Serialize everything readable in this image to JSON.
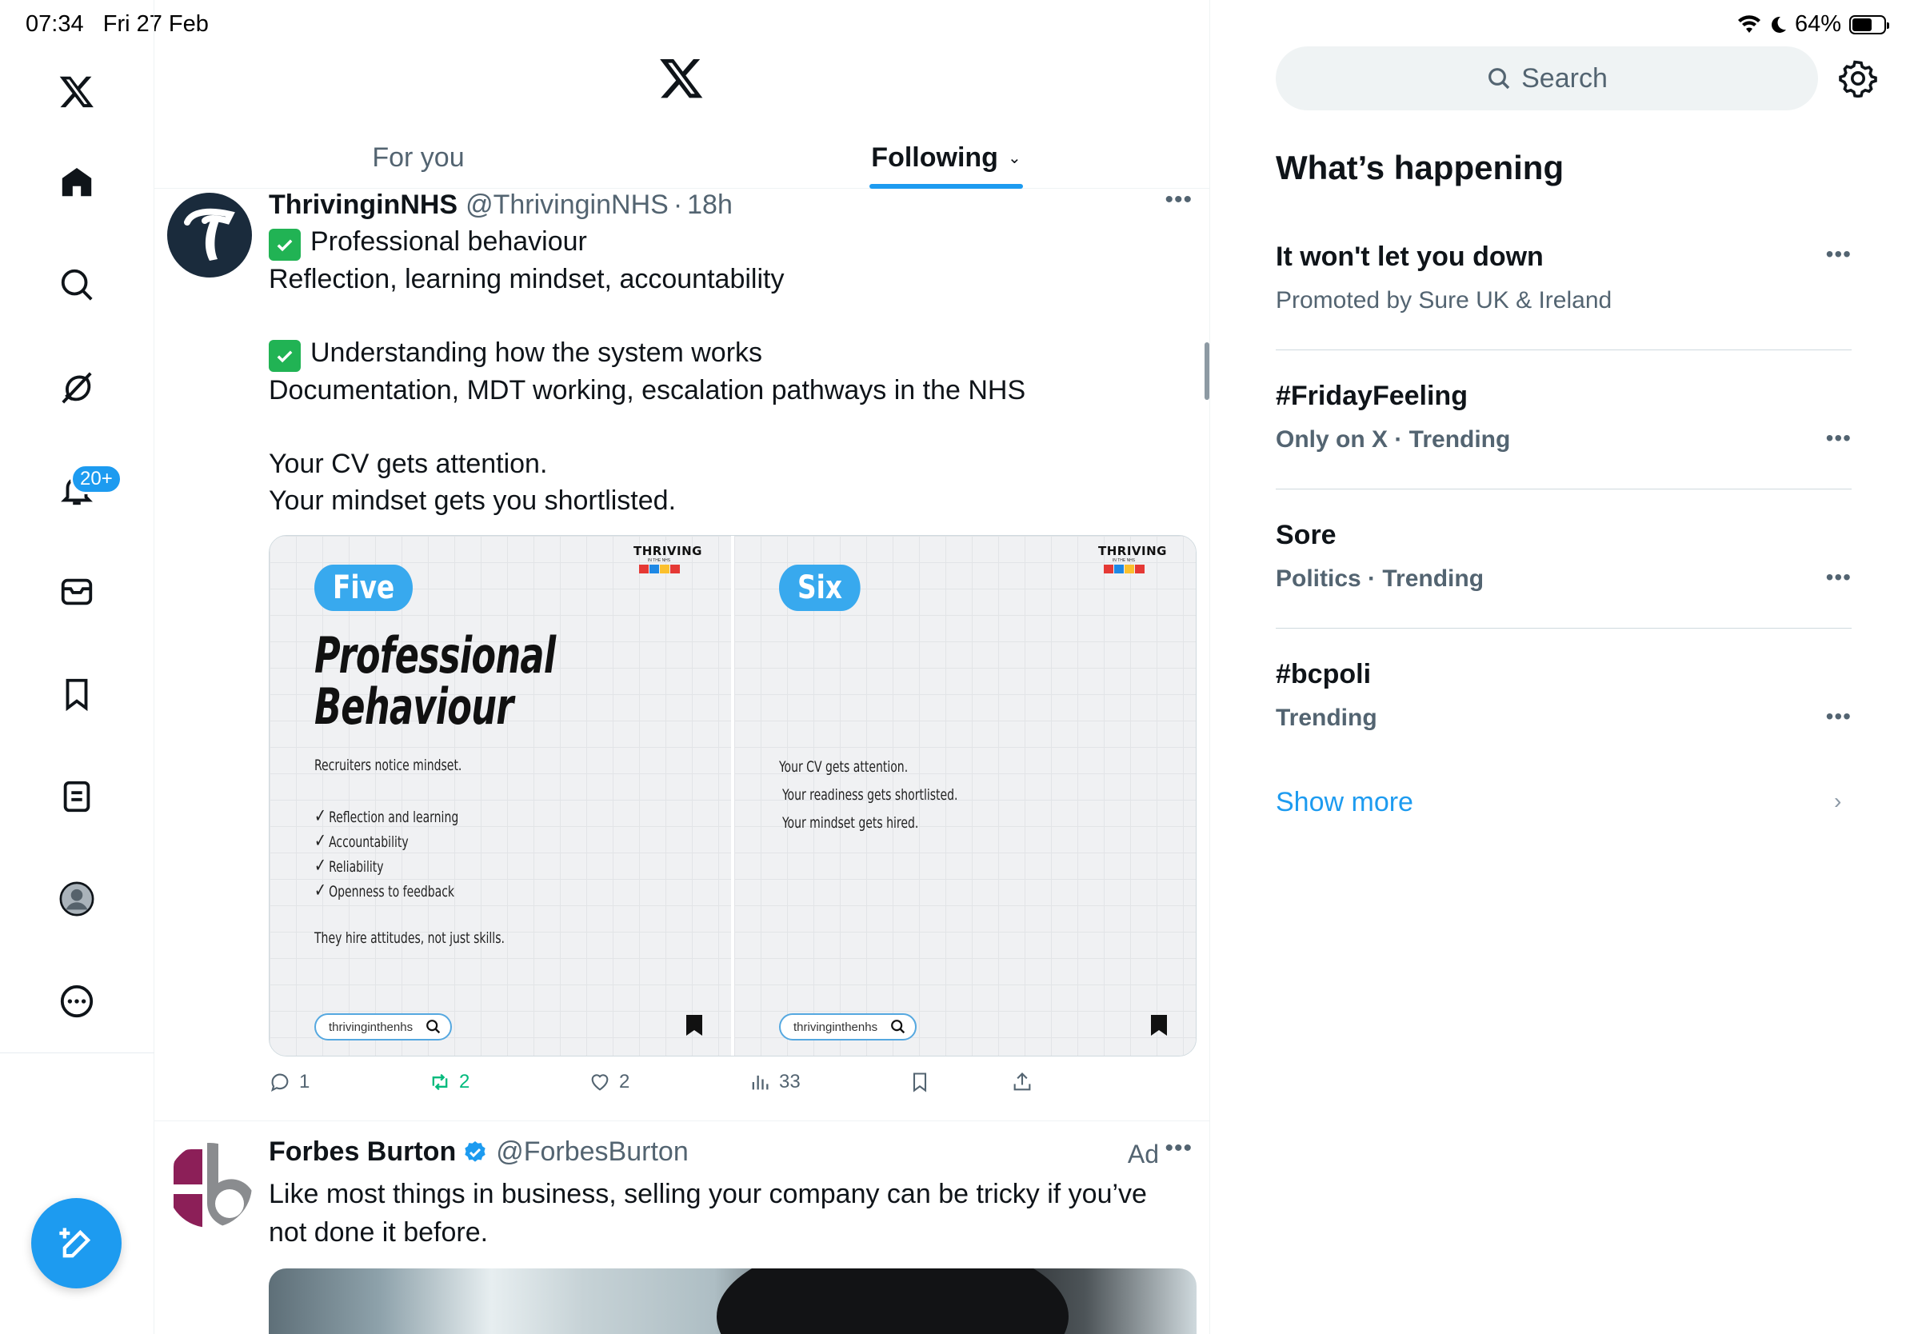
{
  "status": {
    "time": "07:34",
    "date": "Fri 27 Feb",
    "battery": "64%",
    "battery_level": 0.64
  },
  "nav": {
    "icons": [
      "x-logo-icon",
      "home-icon",
      "search-icon",
      "grok-icon",
      "notifications-icon",
      "messages-icon",
      "bookmarks-icon",
      "lists-icon",
      "profile-icon",
      "more-icon"
    ],
    "notifications_badge": "20+",
    "compose": "compose-post-icon"
  },
  "feed": {
    "tabs": [
      {
        "label": "For you",
        "active": false
      },
      {
        "label": "Following",
        "active": true
      }
    ],
    "posts": [
      {
        "name": "ThrivinginNHS",
        "handle": "@ThrivinginNHS",
        "time": "18h",
        "lines": {
          "l1": "Professional behaviour",
          "l2": "Reflection, learning mindset, accountability",
          "l3": "Understanding how the system works",
          "l4": "Documentation, MDT working, escalation pathways in the NHS",
          "l5": "Your CV gets attention.",
          "l6": "Your mindset gets you shortlisted."
        },
        "media": {
          "brand_title": "THRIVING",
          "brand_sub": "IN THE NHS",
          "brand_colors": [
            "#e53935",
            "#1e88e5",
            "#fbc02d",
            "#e53935"
          ],
          "left": {
            "pill": "Five",
            "heading_1": "Professional",
            "heading_2": "Behaviour",
            "intro": "Recruiters notice mindset.",
            "items": [
              "Reflection and learning",
              "Accountability",
              "Reliability",
              "Openness to feedback"
            ],
            "footer": "They hire attitudes, not just skills.",
            "search_text": "thrivinginthenhs"
          },
          "right": {
            "pill": "Six",
            "lines": [
              "Your CV gets attention.",
              "Your readiness gets shortlisted.",
              "Your mindset gets hired."
            ],
            "search_text": "thrivinginthenhs"
          }
        },
        "actions": {
          "replies": "1",
          "reposts": "2",
          "likes": "2",
          "views": "33"
        }
      },
      {
        "name": "Forbes Burton",
        "handle": "@ForbesBurton",
        "ad_label": "Ad",
        "text": "Like most things in business, selling your company can be tricky if you’ve not done it before."
      }
    ]
  },
  "sidebar": {
    "search_placeholder": "Search",
    "title": "What’s happening",
    "trends": [
      {
        "title": "It won't let you down",
        "subtitle": "Promoted by Sure UK & Ireland",
        "bold_sub": false
      },
      {
        "title": "#FridayFeeling",
        "subtitle": "Only on X · Trending",
        "bold_sub": true
      },
      {
        "title": "Sore",
        "subtitle": "Politics · Trending",
        "bold_sub": true
      },
      {
        "title": "#bcpoli",
        "subtitle": "Trending",
        "bold_sub": true
      }
    ],
    "show_more": "Show more",
    "colors": {
      "accent": "#1d9bf0",
      "repost": "#00ba7c"
    }
  }
}
